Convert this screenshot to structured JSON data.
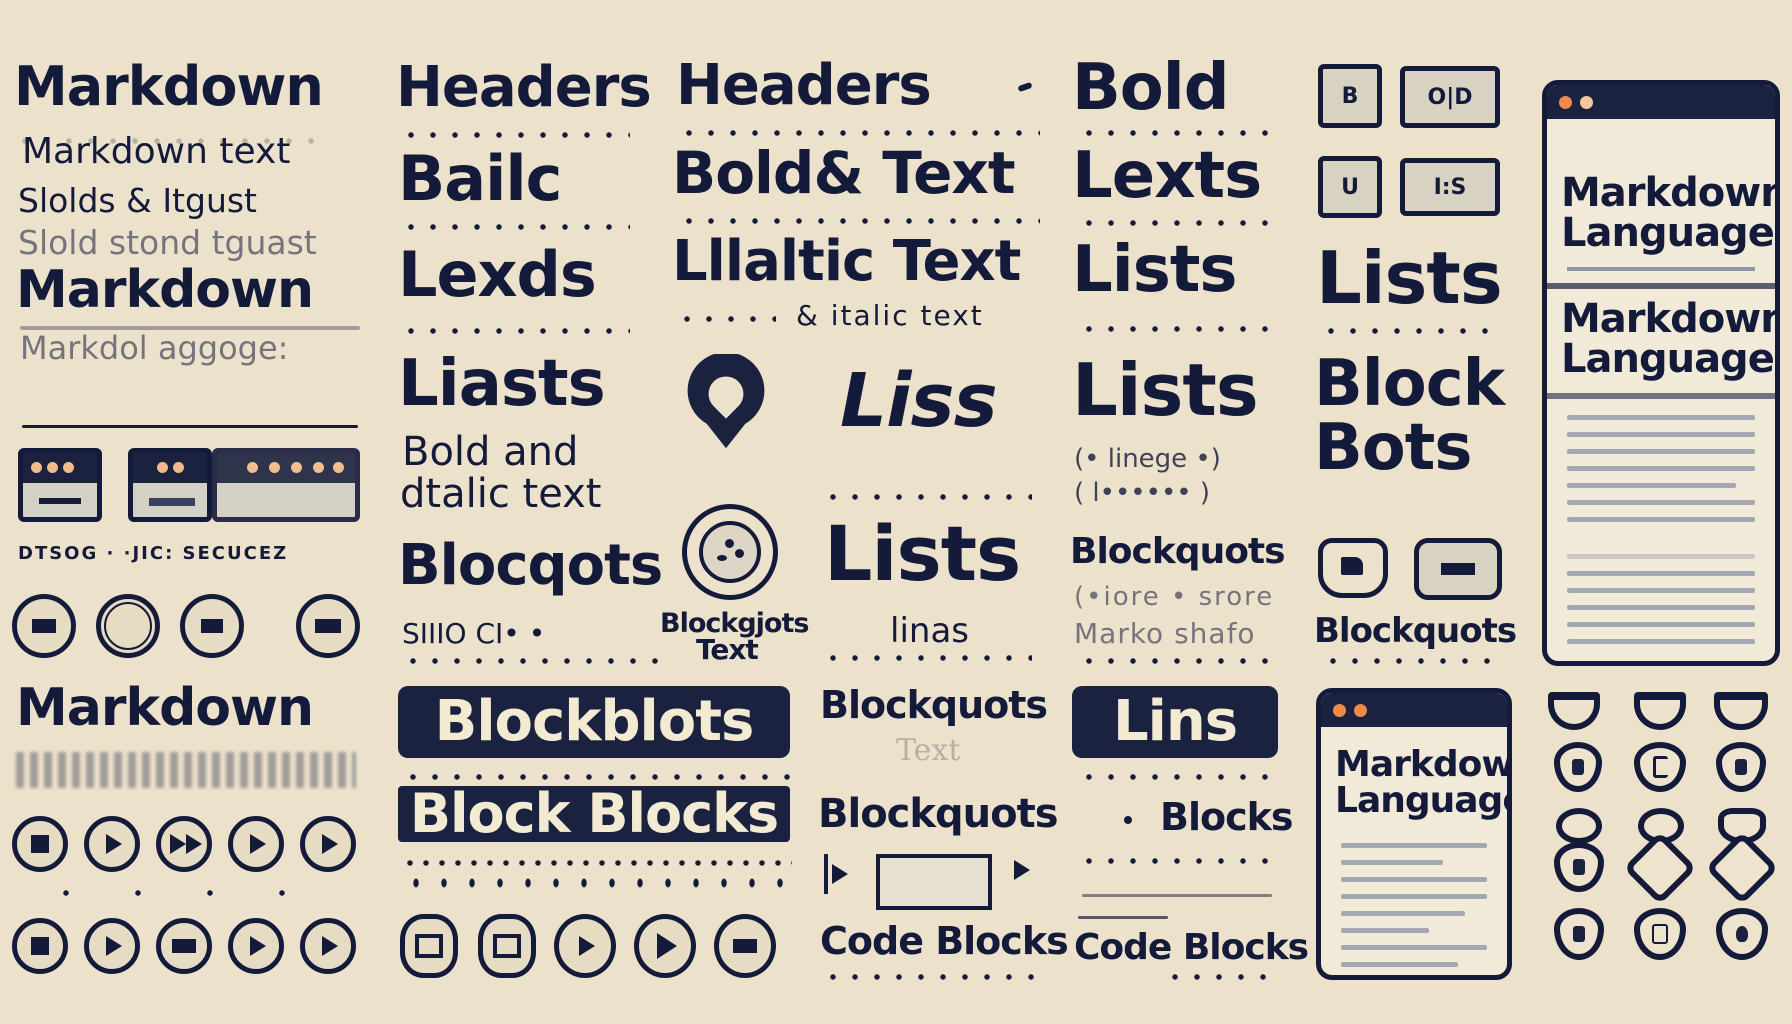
{
  "column1": {
    "title": "Markdown",
    "subtitle": "Markdown text",
    "garbled_1": "Slolds &  Itgust",
    "garbled_2": "Slold stond  tguast",
    "heading_2": "Markdown",
    "garbled_3": "Markdol aggoge:",
    "caption": "DTSOG  ·  ·JIC: SECUCEZ",
    "heading_3": "Markdown"
  },
  "column2": {
    "heading": "Headers",
    "item_1": "Bailc",
    "item_2": "Lexds",
    "item_3": "Liasts",
    "item_4_line1": "Bold and",
    "item_4_line2": "dtalic text",
    "item_5": "Blocqots",
    "item_6": "SIIIO CI• •",
    "pill_1": "Blockblots",
    "pill_2": "Block Blocks"
  },
  "column3": {
    "heading": "Headers",
    "item_1": "Bold& Text",
    "item_2": "Lllaltic Text",
    "item_3": "& italic text",
    "pin_caption_line1": "Blockgjots",
    "pin_caption_line2": "Text",
    "lists_1": "Liss",
    "lists_2": "Lists",
    "lists_sub": "linas",
    "blockquote_1": "Blockquots",
    "blockquote_faded": "Text",
    "blockquote_2": "Blockquots",
    "code_blocks": "Code Blocks"
  },
  "column4": {
    "heading": "Bold",
    "item_1": "Lexts",
    "item_2": "Lists",
    "item_3": "Lists",
    "item_3_sub_1": "(• linege •)",
    "item_3_sub_2": "( l•••••• )",
    "blockquote": "Blockquots",
    "bq_sub_1": "(•iore • srore",
    "bq_sub_2": "Marko shafo",
    "pill": "Lins",
    "blocks": "Blocks",
    "code_blocks": "Code Blocks"
  },
  "column5": {
    "box_1": "B",
    "box_2": "O|D",
    "box_3": "U",
    "box_4": "I:S",
    "lists": "Lists",
    "block_line1": "Block",
    "block_line2": "Bots",
    "blockquote": "Blockquots",
    "window_title": "Markdown\nLanguage"
  },
  "column6": {
    "window_title_1": "Markdown\nLanguage",
    "window_title_2": "Markdown\nLanguage"
  },
  "colors": {
    "background": "#ece2cc",
    "ink": "#141a3a",
    "accent_orange": "#f08a4b"
  }
}
